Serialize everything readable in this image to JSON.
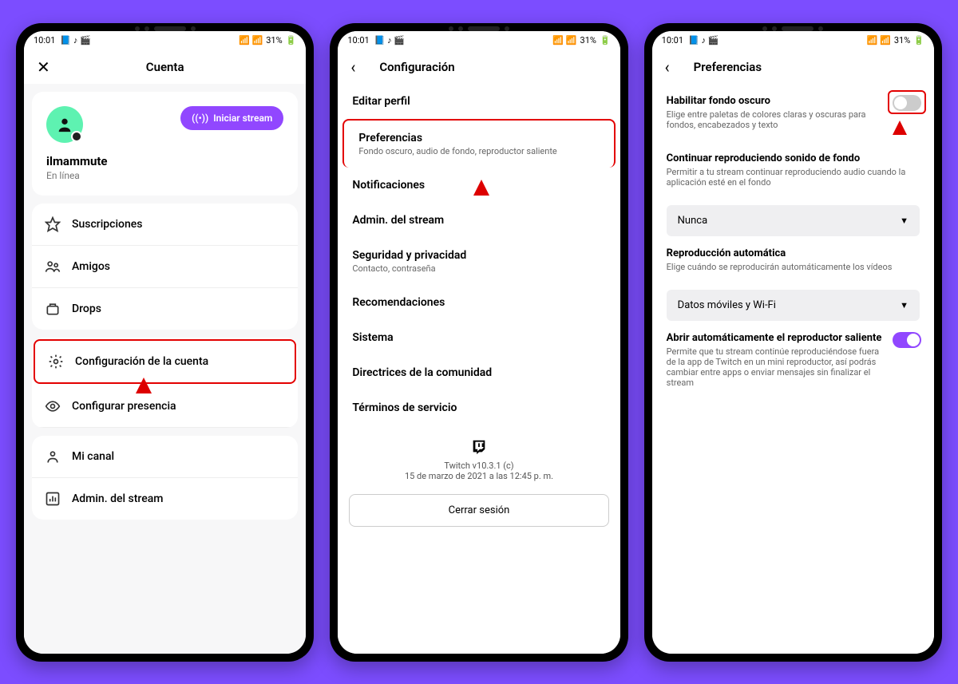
{
  "statusbar": {
    "time": "10:01",
    "battery": "31%"
  },
  "phone1": {
    "title": "Cuenta",
    "username": "ilmammute",
    "status": "En línea",
    "stream_btn": "Iniciar stream",
    "items_a": [
      {
        "icon": "star",
        "label": "Suscripciones"
      },
      {
        "icon": "friends",
        "label": "Amigos"
      },
      {
        "icon": "drops",
        "label": "Drops"
      }
    ],
    "items_b": [
      {
        "icon": "gear",
        "label": "Configuración de la cuenta",
        "hl": true
      },
      {
        "icon": "eye",
        "label": "Configurar presencia"
      }
    ],
    "items_c": [
      {
        "icon": "person",
        "label": "Mi canal"
      },
      {
        "icon": "dashboard",
        "label": "Admin. del stream"
      }
    ]
  },
  "phone2": {
    "title": "Configuración",
    "items": [
      {
        "t": "Editar perfil"
      },
      {
        "t": "Preferencias",
        "s": "Fondo oscuro, audio de fondo, reproductor saliente",
        "hl": true
      },
      {
        "t": "Notificaciones"
      },
      {
        "t": "Admin. del stream"
      },
      {
        "t": "Seguridad y privacidad",
        "s": "Contacto, contraseña"
      },
      {
        "t": "Recomendaciones"
      },
      {
        "t": "Sistema"
      },
      {
        "t": "Directrices de la comunidad"
      },
      {
        "t": "Términos de servicio"
      }
    ],
    "version": "Twitch v10.3.1 (c)",
    "build_date": "15 de marzo de 2021 a las 12:45 p. m.",
    "logout": "Cerrar sesión"
  },
  "phone3": {
    "title": "Preferencias",
    "dark": {
      "t": "Habilitar fondo oscuro",
      "s": "Elige entre paletas de colores claras y oscuras para fondos, encabezados y texto"
    },
    "bg_audio": {
      "t": "Continuar reproduciendo sonido de fondo",
      "s": "Permitir a tu stream continuar reproduciendo audio cuando la aplicación esté en el fondo",
      "value": "Nunca"
    },
    "autoplay": {
      "t": "Reproducción automática",
      "s": "Elige cuándo se reproducirán automáticamente los vídeos",
      "value": "Datos móviles y Wi-Fi"
    },
    "pip": {
      "t": "Abrir automáticamente el reproductor saliente",
      "s": "Permite que tu stream continúe reproduciéndose fuera de la app de Twitch en un mini reproductor, así podrás cambiar entre apps o enviar mensajes sin finalizar el stream"
    }
  }
}
